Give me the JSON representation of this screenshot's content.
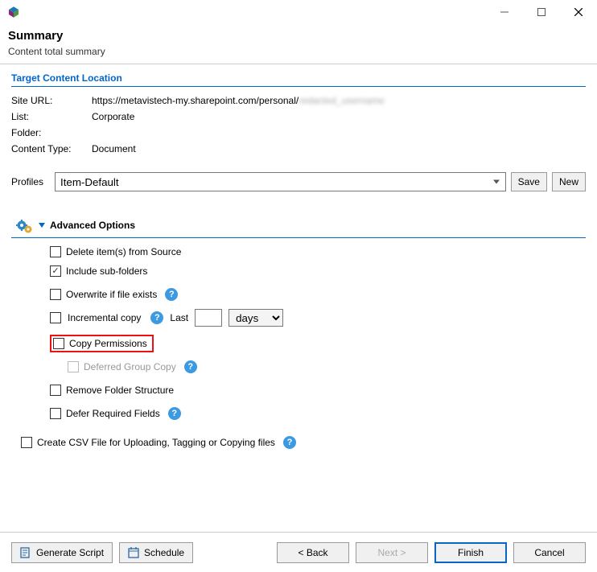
{
  "header": {
    "title": "Summary",
    "subtitle": "Content total summary"
  },
  "target": {
    "section_title": "Target Content Location",
    "site_url_label": "Site URL:",
    "site_url_value": "https://metavistech-my.sharepoint.com/personal/",
    "site_url_hidden": "redacted_username",
    "list_label": "List:",
    "list_value": "Corporate",
    "folder_label": "Folder:",
    "folder_value": "",
    "content_type_label": "Content Type:",
    "content_type_value": "Document"
  },
  "profiles": {
    "label": "Profiles",
    "value": "Item-Default",
    "save": "Save",
    "new": "New"
  },
  "advanced": {
    "title": "Advanced Options",
    "delete_source": "Delete item(s) from Source",
    "include_subfolders": "Include sub-folders",
    "overwrite": "Overwrite if file exists",
    "incremental": "Incremental copy",
    "last_label": "Last",
    "days_value": "",
    "days_unit": "days",
    "copy_permissions": "Copy Permissions",
    "deferred_group": "Deferred Group Copy",
    "remove_folder": "Remove Folder Structure",
    "defer_required": "Defer Required Fields"
  },
  "csv": {
    "label": "Create CSV File for Uploading, Tagging or Copying files"
  },
  "footer": {
    "generate_script": "Generate Script",
    "schedule": "Schedule",
    "back": "< Back",
    "next": "Next >",
    "finish": "Finish",
    "cancel": "Cancel"
  }
}
